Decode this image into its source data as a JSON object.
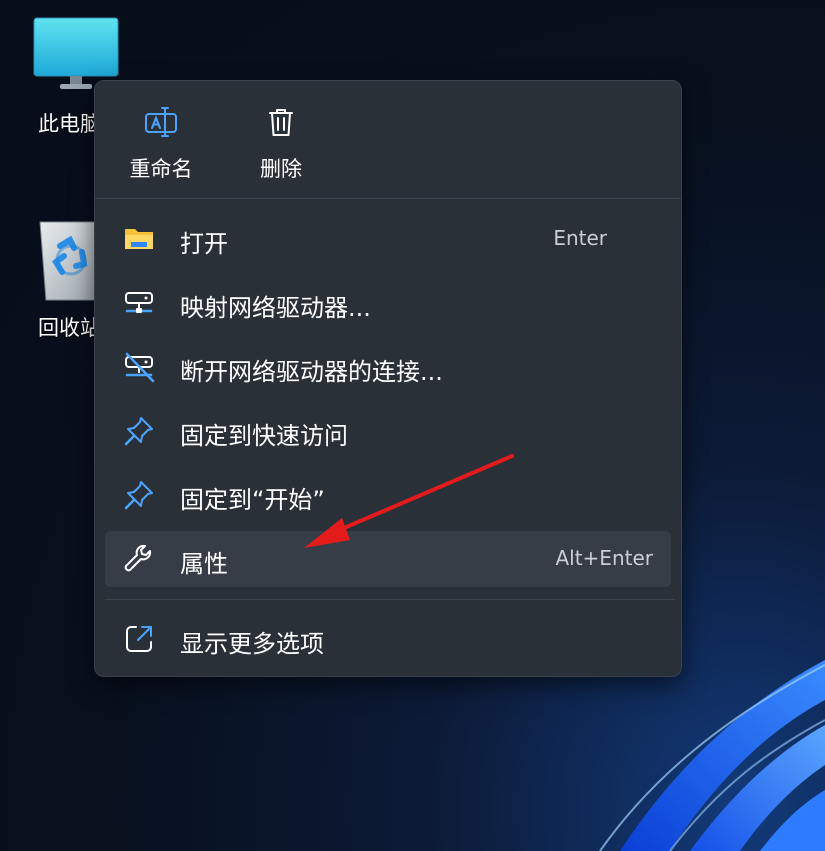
{
  "desktop": {
    "icons": [
      {
        "name": "this-pc",
        "label": "此电脑"
      },
      {
        "name": "recycle-bin",
        "label": "回收站"
      }
    ]
  },
  "context_menu": {
    "top_actions": [
      {
        "label": "重命名",
        "icon": "rename-icon"
      },
      {
        "label": "删除",
        "icon": "trash-icon"
      }
    ],
    "items": [
      {
        "label": "打开",
        "shortcut": "Enter",
        "icon": "folder-icon"
      },
      {
        "label": "映射网络驱动器...",
        "shortcut": "",
        "icon": "network-drive-icon"
      },
      {
        "label": "断开网络驱动器的连接...",
        "shortcut": "",
        "icon": "disconnect-network-drive-icon"
      },
      {
        "label": "固定到快速访问",
        "shortcut": "",
        "icon": "pin-icon"
      },
      {
        "label": "固定到“开始”",
        "shortcut": "",
        "icon": "pin-icon"
      },
      {
        "label": "属性",
        "shortcut": "Alt+Enter",
        "icon": "wrench-icon",
        "highlighted": true
      }
    ],
    "more_options": {
      "label": "显示更多选项",
      "icon": "open-external-icon"
    }
  },
  "colors": {
    "menu_bg": "#2a3038",
    "highlight_bg": "#373d46",
    "accent_blue": "#4ca3ff",
    "folder_yellow": "#f6c23a",
    "annotation_red": "#e31b1b"
  }
}
